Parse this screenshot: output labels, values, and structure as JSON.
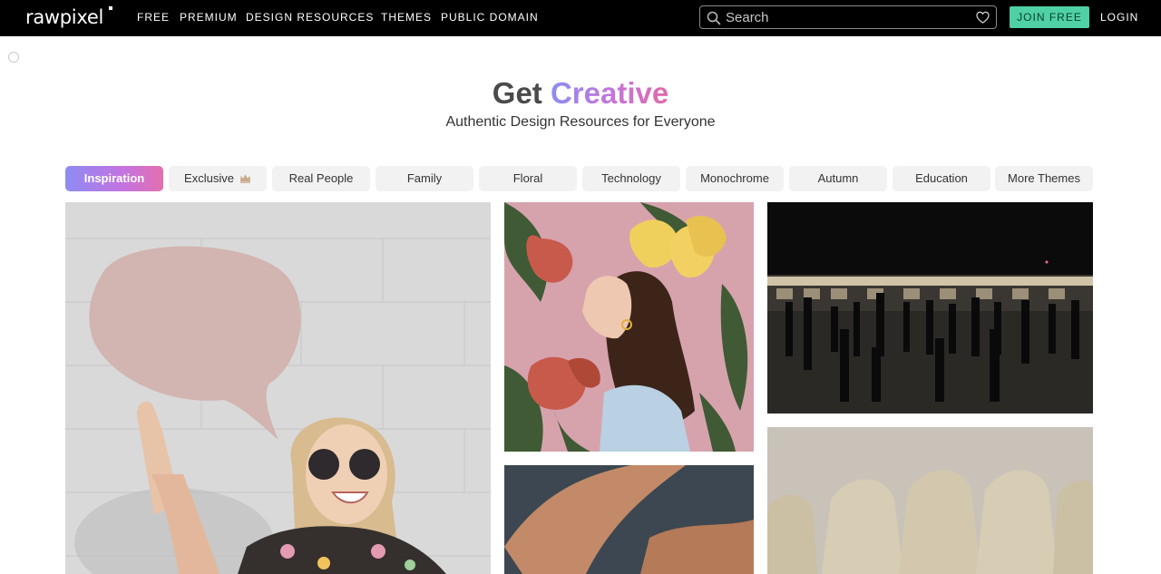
{
  "brand": {
    "logo_text": "rawpixel"
  },
  "nav": {
    "links": [
      "FREE",
      "PREMIUM",
      "DESIGN RESOURCES",
      "THEMES",
      "PUBLIC DOMAIN"
    ],
    "search_placeholder": "Search",
    "join_label": "JOIN FREE",
    "login_label": "LOGIN"
  },
  "hero": {
    "title_plain": "Get",
    "title_highlight": "Creative",
    "subtitle": "Authentic Design Resources for Everyone"
  },
  "themes": {
    "selected": "Inspiration",
    "chips": [
      "Inspiration",
      "Exclusive",
      "Real People",
      "Family",
      "Floral",
      "Technology",
      "Monochrome",
      "Autumn",
      "Education",
      "More Themes"
    ]
  },
  "images": [
    {
      "subject": "woman holding pink speech bubble"
    },
    {
      "subject": "illustrated woman with tulips"
    },
    {
      "subject": "silhouettes at subway station"
    },
    {
      "subject": "close-up of hands"
    },
    {
      "subject": "row of beige chairs"
    }
  ],
  "colors": {
    "nav_bg": "#000000",
    "join_accent": "#4fd1a5",
    "gradient_start": "#8d8cf2",
    "gradient_end": "#e06aa8",
    "chip_bg": "#f2f2f2"
  },
  "icons": [
    "search-icon",
    "heart-icon",
    "crown-icon"
  ]
}
